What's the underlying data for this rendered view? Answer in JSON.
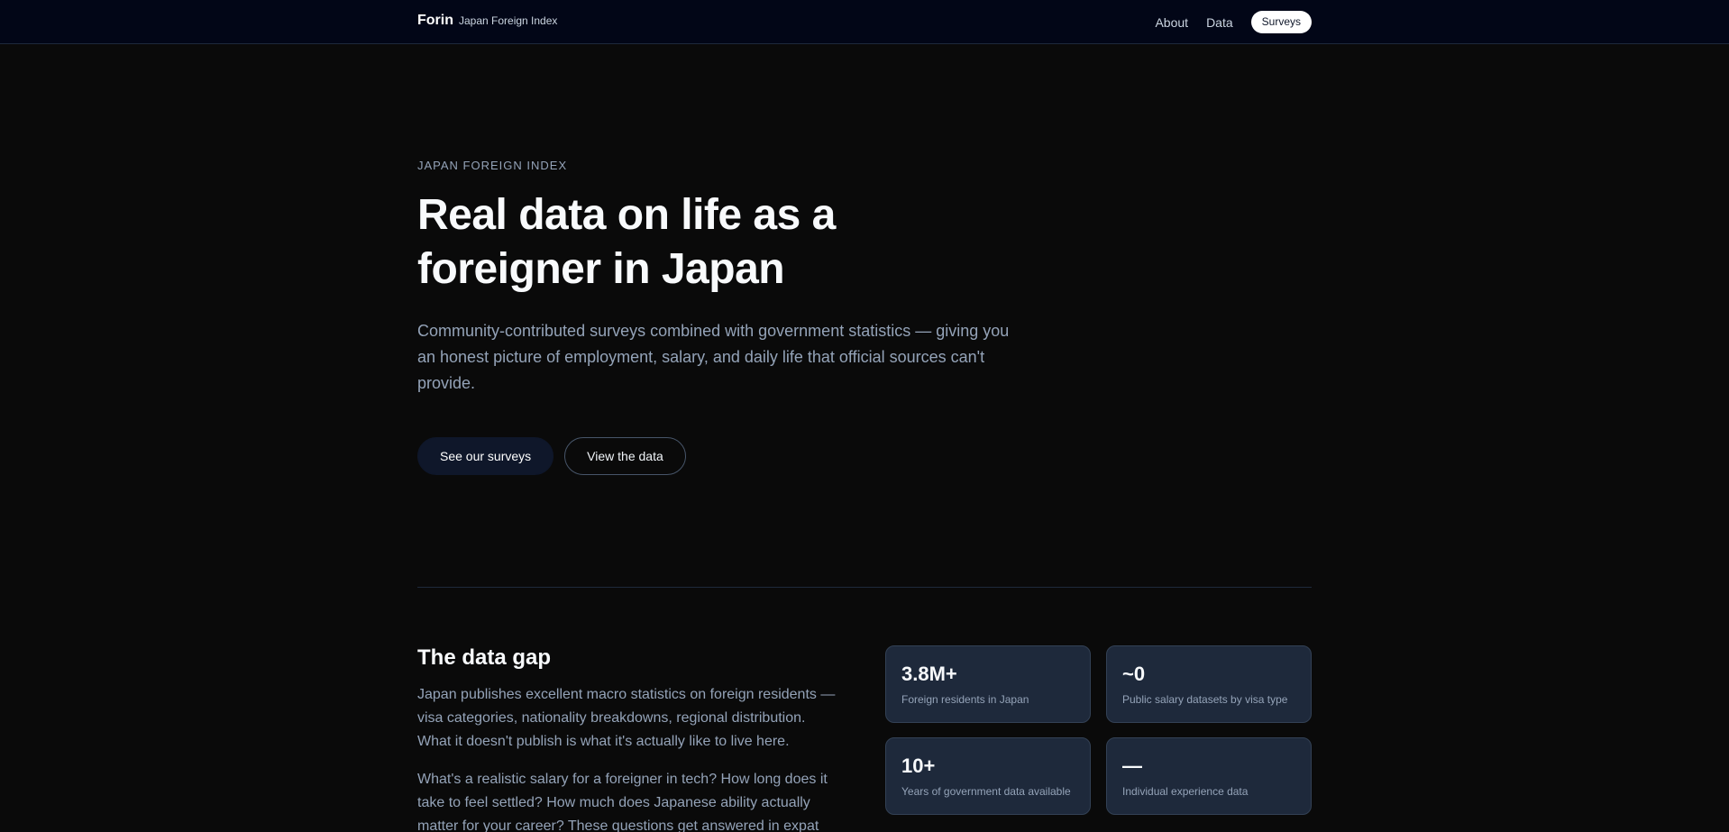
{
  "nav": {
    "brand": "Forin",
    "brand_sub": "Japan Foreign Index",
    "links": [
      "About",
      "Data"
    ],
    "cta": "Surveys"
  },
  "hero": {
    "eyebrow": "JAPAN FOREIGN INDEX",
    "title": "Real data on life as a foreigner in Japan",
    "description": "Community-contributed surveys combined with government statistics — giving you an honest picture of employment, salary, and daily life that official sources can't provide.",
    "primary_button": "See our surveys",
    "secondary_button": "View the data"
  },
  "gap": {
    "title": "The data gap",
    "p1": "Japan publishes excellent macro statistics on foreign residents — visa categories, nationality breakdowns, regional distribution. What it doesn't publish is what it's actually like to live here.",
    "p2": "What's a realistic salary for a foreigner in tech? How long does it take to feel settled? How much does Japanese ability actually matter for your career? These questions get answered in expat"
  },
  "stats": [
    {
      "value": "3.8M+",
      "label": "Foreign residents in Japan"
    },
    {
      "value": "~0",
      "label": "Public salary datasets by visa type"
    },
    {
      "value": "10+",
      "label": "Years of government data available"
    },
    {
      "value": "—",
      "label": "Individual experience data"
    }
  ],
  "colors": {
    "background": "#0a0a0a",
    "nav_background": "#020617",
    "card_background": "#1e293b",
    "muted_text": "#94a3b8"
  }
}
